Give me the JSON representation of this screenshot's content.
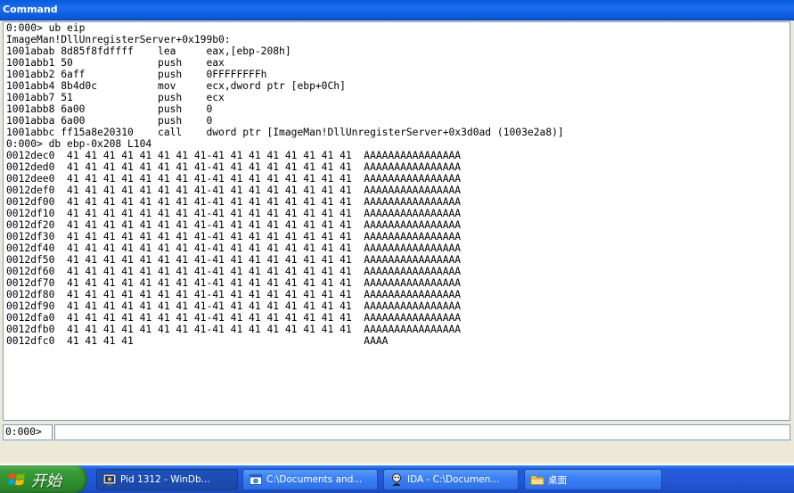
{
  "window": {
    "title": "Command"
  },
  "output": {
    "lines": [
      "0:000> ub eip",
      "ImageMan!DllUnregisterServer+0x199b0:",
      "1001abab 8d85f8fdffff    lea     eax,[ebp-208h]",
      "1001abb1 50              push    eax",
      "1001abb2 6aff            push    0FFFFFFFFh",
      "1001abb4 8b4d0c          mov     ecx,dword ptr [ebp+0Ch]",
      "1001abb7 51              push    ecx",
      "1001abb8 6a00            push    0",
      "1001abba 6a00            push    0",
      "1001abbc ff15a8e20310    call    dword ptr [ImageMan!DllUnregisterServer+0x3d0ad (1003e2a8)]",
      "0:000> db ebp-0x208 L104",
      "0012dec0  41 41 41 41 41 41 41 41-41 41 41 41 41 41 41 41  AAAAAAAAAAAAAAAA",
      "0012ded0  41 41 41 41 41 41 41 41-41 41 41 41 41 41 41 41  AAAAAAAAAAAAAAAA",
      "0012dee0  41 41 41 41 41 41 41 41-41 41 41 41 41 41 41 41  AAAAAAAAAAAAAAAA",
      "0012def0  41 41 41 41 41 41 41 41-41 41 41 41 41 41 41 41  AAAAAAAAAAAAAAAA",
      "0012df00  41 41 41 41 41 41 41 41-41 41 41 41 41 41 41 41  AAAAAAAAAAAAAAAA",
      "0012df10  41 41 41 41 41 41 41 41-41 41 41 41 41 41 41 41  AAAAAAAAAAAAAAAA",
      "0012df20  41 41 41 41 41 41 41 41-41 41 41 41 41 41 41 41  AAAAAAAAAAAAAAAA",
      "0012df30  41 41 41 41 41 41 41 41-41 41 41 41 41 41 41 41  AAAAAAAAAAAAAAAA",
      "0012df40  41 41 41 41 41 41 41 41-41 41 41 41 41 41 41 41  AAAAAAAAAAAAAAAA",
      "0012df50  41 41 41 41 41 41 41 41-41 41 41 41 41 41 41 41  AAAAAAAAAAAAAAAA",
      "0012df60  41 41 41 41 41 41 41 41-41 41 41 41 41 41 41 41  AAAAAAAAAAAAAAAA",
      "0012df70  41 41 41 41 41 41 41 41-41 41 41 41 41 41 41 41  AAAAAAAAAAAAAAAA",
      "0012df80  41 41 41 41 41 41 41 41-41 41 41 41 41 41 41 41  AAAAAAAAAAAAAAAA",
      "0012df90  41 41 41 41 41 41 41 41-41 41 41 41 41 41 41 41  AAAAAAAAAAAAAAAA",
      "0012dfa0  41 41 41 41 41 41 41 41-41 41 41 41 41 41 41 41  AAAAAAAAAAAAAAAA",
      "0012dfb0  41 41 41 41 41 41 41 41-41 41 41 41 41 41 41 41  AAAAAAAAAAAAAAAA",
      "0012dfc0  41 41 41 41                                      AAAA"
    ]
  },
  "command": {
    "prompt": "0:000>",
    "value": ""
  },
  "taskbar": {
    "start_label": "开始",
    "buttons": [
      {
        "label": "Pid 1312 - WinDb...",
        "icon": "windbg-icon"
      },
      {
        "label": "C:\\Documents and...",
        "icon": "explorer-window-icon"
      },
      {
        "label": "IDA - C:\\Documen...",
        "icon": "ida-icon"
      },
      {
        "label": "桌面",
        "icon": "desktop-folder-icon"
      }
    ]
  },
  "colors": {
    "titlebar": "#0a5bd9",
    "window_bg": "#ece9d8",
    "taskbar": "#245edb",
    "start": "#3a9c3a"
  }
}
